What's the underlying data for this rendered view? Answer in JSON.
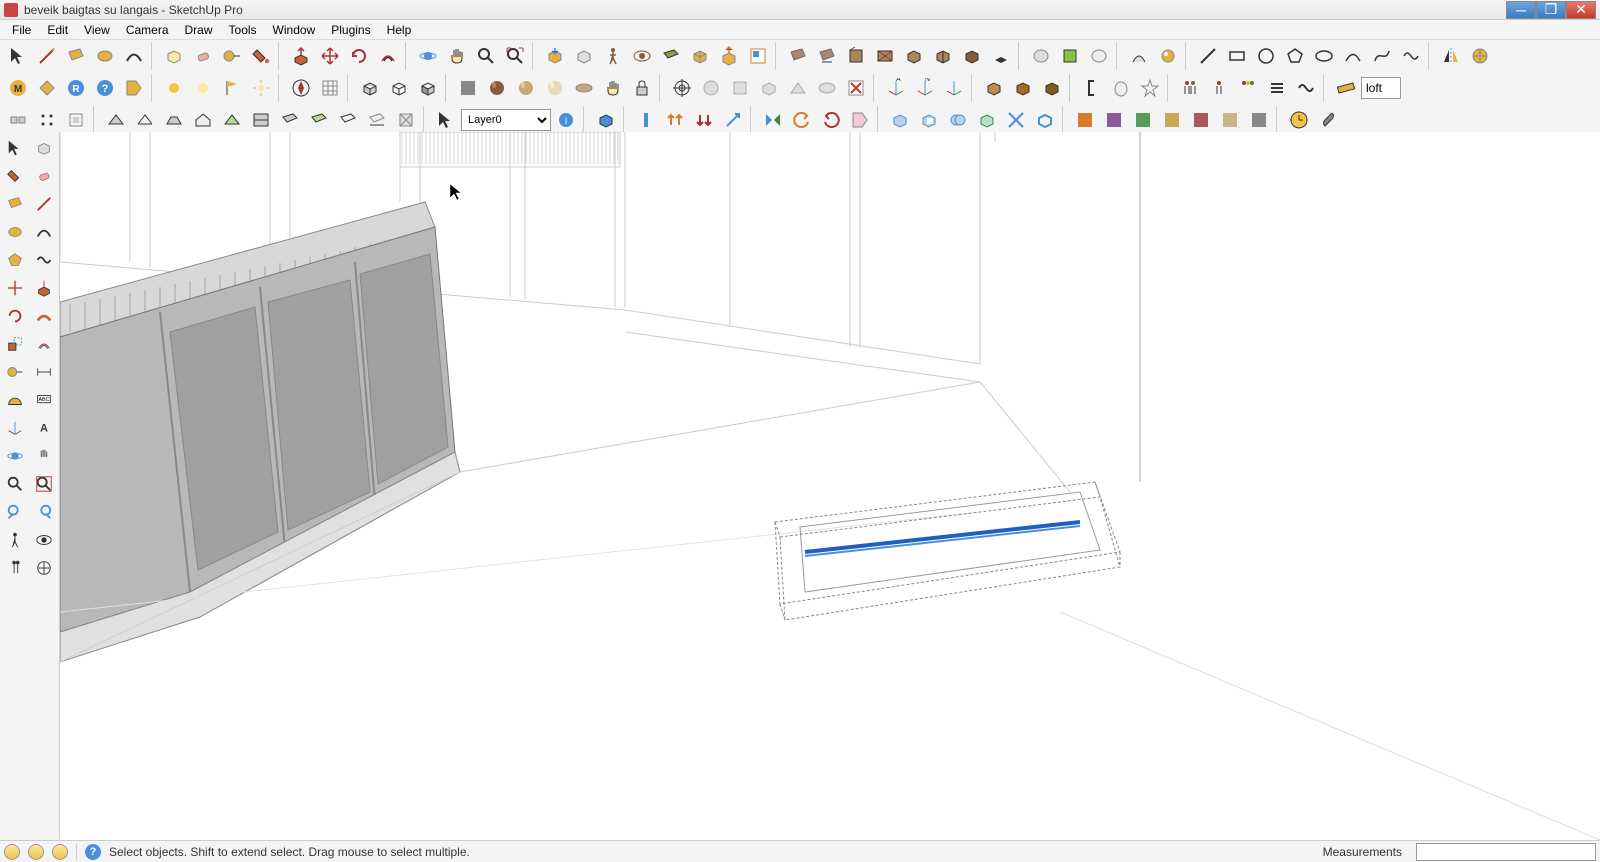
{
  "window": {
    "title": "beveik baigtas su langais - SketchUp Pro"
  },
  "menu": {
    "items": [
      "File",
      "Edit",
      "View",
      "Camera",
      "Draw",
      "Tools",
      "Window",
      "Plugins",
      "Help"
    ]
  },
  "toolbars": {
    "layer_selected": "Layer0",
    "loft_label": "loft"
  },
  "status": {
    "hint": "Select objects. Shift to extend select. Drag mouse to select multiple.",
    "measurements_label": "Measurements",
    "measurements_value": ""
  },
  "icons": {
    "select": "▸",
    "pencil": "✎",
    "rect": "▭",
    "circle": "○",
    "arc": "⌒",
    "eraser": "◧",
    "tape": "⊟",
    "paint": "◍",
    "pushpull": "⬍",
    "move": "✥",
    "rotate": "↻",
    "offset": "⟳",
    "orbit": "⥁",
    "pan": "✋",
    "zoom": "🔍",
    "zoomext": "⊡",
    "component": "◫",
    "group": "▣",
    "dims": "⟷",
    "text": "A"
  }
}
